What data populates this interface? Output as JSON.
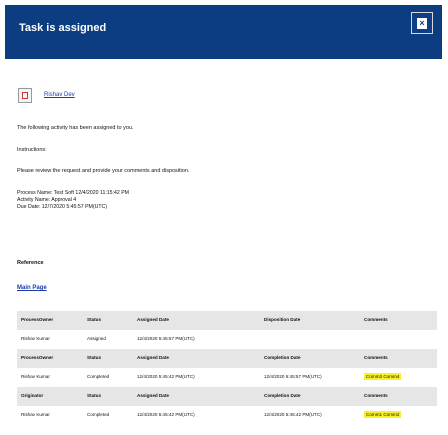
{
  "header": {
    "title": "Task is assigned",
    "close_icon": "close-icon"
  },
  "user": {
    "name": "Rishav Dev",
    "icon": "user-icon"
  },
  "message": {
    "intro": "The following activity has been assigned to you.",
    "instructions_label": "Instructions:",
    "instructions_text": "Please review the request and provide your comments and disposition.",
    "process_name": "Process Name: Test Soft 12/4/2020 11:15:42 PM",
    "activity_name": "Activity Name: Approval 4",
    "due_date": "Due Date: 12/7/2020 5:45:57 PM(UTC)"
  },
  "reference": {
    "label": "Reference",
    "main_page": "Main Page"
  },
  "table": {
    "rows": [
      {
        "type": "header",
        "c1": "ProcessOwner",
        "c2": "Status",
        "c3": "Assigned Date",
        "c4": "Disposition Date",
        "c5": "Comments"
      },
      {
        "type": "data",
        "c1": "Rishav Kumar",
        "c2": "Assigned",
        "c3": "12/4/2020 5:45:57 PM(UTC)",
        "c4": "",
        "c5": ""
      },
      {
        "type": "header",
        "c1": "ProcessOwner",
        "c2": "Status",
        "c3": "Assigned Date",
        "c4": "Completion Date",
        "c5": "Comments"
      },
      {
        "type": "data",
        "c1": "Rishav Kumar",
        "c2": "Completed",
        "c3": "12/4/2020 5:45:42 PM(UTC)",
        "c4": "12/4/2020 5:45:57 PM(UTC)",
        "c5": "Comm3 Comm4"
      },
      {
        "type": "header",
        "c1": "Originator",
        "c2": "Status",
        "c3": "Assigned Date",
        "c4": "Completion Date",
        "c5": "Comments"
      },
      {
        "type": "data",
        "c1": "Rishav Kumar",
        "c2": "Completed",
        "c3": "12/4/2020 5:45:42 PM(UTC)",
        "c4": "12/4/2020 5:45:42 PM(UTC)",
        "c5": "Comm1 Comm2"
      }
    ]
  },
  "colors": {
    "header_bg": "#0b3d80",
    "link": "#1a3ca8",
    "highlight": "#f7f02a",
    "table_header_bg": "#e6e6e6"
  }
}
